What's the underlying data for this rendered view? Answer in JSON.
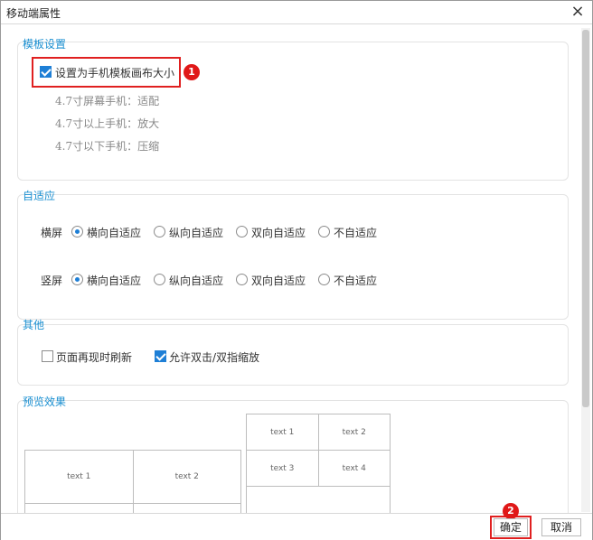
{
  "dialog": {
    "title": "移动端属性",
    "close_glyph": "×"
  },
  "template_settings": {
    "title": "模板设置",
    "canvas_checkbox_label": "设置为手机模板画布大小",
    "canvas_checkbox_checked": true,
    "notes": [
      "4.7寸屏幕手机：适配",
      "4.7寸以上手机：放大",
      "4.7寸以下手机：压缩"
    ]
  },
  "adaptive": {
    "title": "自适应",
    "rows": [
      {
        "label": "横屏",
        "options": [
          "横向自适应",
          "纵向自适应",
          "双向自适应",
          "不自适应"
        ],
        "selected": 0
      },
      {
        "label": "竖屏",
        "options": [
          "横向自适应",
          "纵向自适应",
          "双向自适应",
          "不自适应"
        ],
        "selected": 0
      }
    ]
  },
  "other": {
    "title": "其他",
    "refresh_label": "页面再现时刷新",
    "refresh_checked": false,
    "zoom_label": "允许双击/双指缩放",
    "zoom_checked": true
  },
  "preview": {
    "title": "预览效果",
    "landscape_cells": [
      "text 1",
      "text 2"
    ],
    "portrait_cells": [
      "text 1",
      "text 2",
      "text 3",
      "text 4"
    ]
  },
  "annotations": {
    "badge1": "1",
    "badge2": "2",
    "highlight_color": "#e02020"
  },
  "footer": {
    "ok_label": "确定",
    "cancel_label": "取消"
  },
  "colors": {
    "accent": "#1e7fd6",
    "section_title": "#1a8fd1"
  }
}
